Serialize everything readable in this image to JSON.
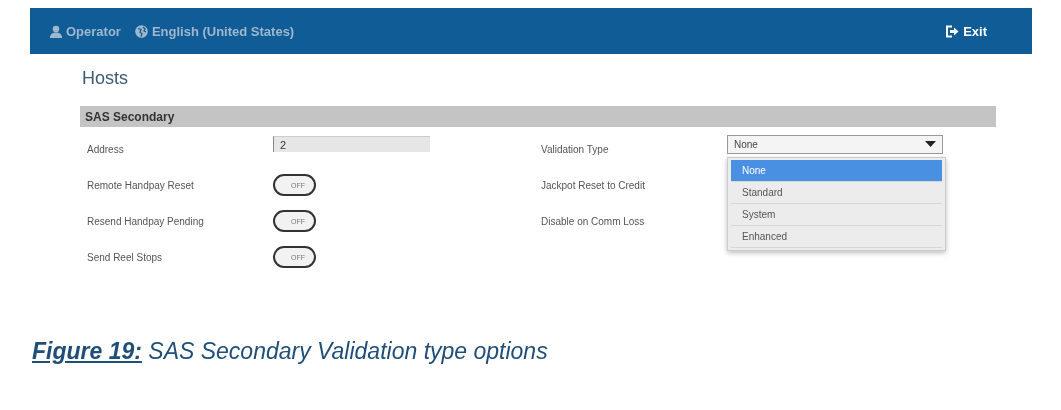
{
  "header": {
    "user": "Operator",
    "language": "English (United States)",
    "exit": "Exit"
  },
  "page_title": "Hosts",
  "section": {
    "title": "SAS Secondary",
    "left_rows": [
      {
        "label": "Address",
        "kind": "text",
        "value": "2"
      },
      {
        "label": "Remote Handpay Reset",
        "kind": "toggle",
        "on": false,
        "text": "OFF"
      },
      {
        "label": "Resend Handpay Pending",
        "kind": "toggle",
        "on": false,
        "text": "OFF"
      },
      {
        "label": "Send Reel Stops",
        "kind": "toggle",
        "on": false,
        "text": "OFF"
      }
    ],
    "right_rows": [
      {
        "label": "Validation Type",
        "kind": "select",
        "value": "None",
        "expanded": true,
        "options": [
          {
            "label": "None",
            "selected": true
          },
          {
            "label": "Standard",
            "selected": false
          },
          {
            "label": "System",
            "selected": false
          },
          {
            "label": "Enhanced",
            "selected": false
          }
        ]
      },
      {
        "label": "Jackpot Reset to Credit"
      },
      {
        "label": "Disable on Comm Loss"
      }
    ]
  },
  "caption": "**Figure 19:** SAS Secondary Validation type options"
}
